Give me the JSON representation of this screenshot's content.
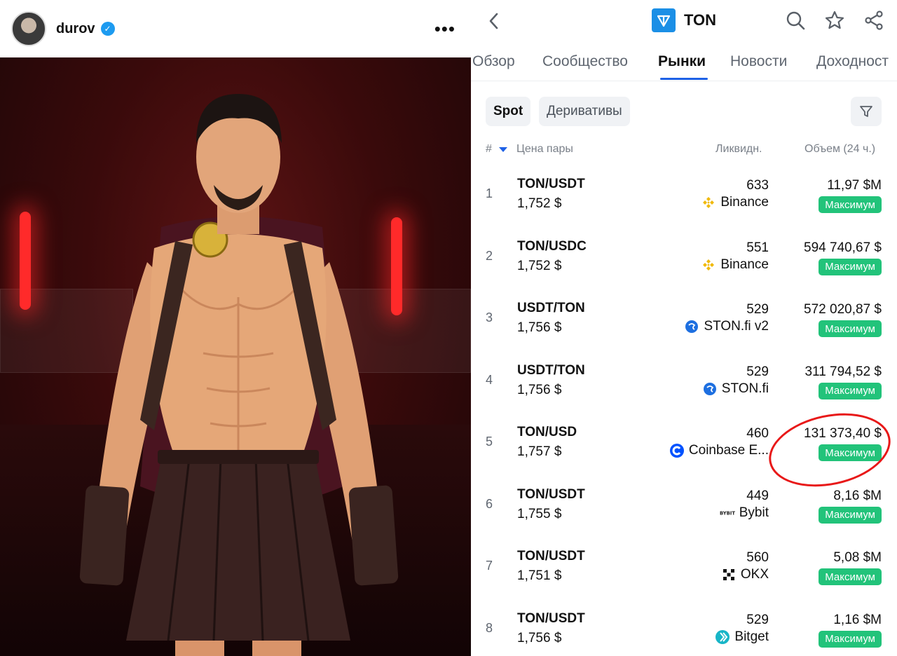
{
  "post": {
    "username": "durov",
    "more_label": "•••"
  },
  "panel": {
    "token": "TON",
    "tabs": [
      "Обзор",
      "Сообщество",
      "Рынки",
      "Новости",
      "Доходност"
    ],
    "active_tab": "Рынки",
    "chips": [
      "Spot",
      "Деривативы"
    ],
    "columns": {
      "rank": "#",
      "pair": "Цена пары",
      "liquidity": "Ликвидн.",
      "volume": "Объем (24 ч.)"
    },
    "rows": [
      {
        "rank": "1",
        "pair": "TON/USDT",
        "price": "1,752 $",
        "liquidity": "633",
        "exchange": "Binance",
        "exchange_icon": "binance-icon",
        "volume": "11,97 $M",
        "badge": "Максимум"
      },
      {
        "rank": "2",
        "pair": "TON/USDC",
        "price": "1,752 $",
        "liquidity": "551",
        "exchange": "Binance",
        "exchange_icon": "binance-icon",
        "volume": "594 740,67 $",
        "badge": "Максимум"
      },
      {
        "rank": "3",
        "pair": "USDT/TON",
        "price": "1,756 $",
        "liquidity": "529",
        "exchange": "STON.fi v2",
        "exchange_icon": "stonfi-icon",
        "volume": "572 020,87 $",
        "badge": "Максимум"
      },
      {
        "rank": "4",
        "pair": "USDT/TON",
        "price": "1,756 $",
        "liquidity": "529",
        "exchange": "STON.fi",
        "exchange_icon": "stonfi-icon",
        "volume": "311 794,52 $",
        "badge": "Максимум"
      },
      {
        "rank": "5",
        "pair": "TON/USD",
        "price": "1,757 $",
        "liquidity": "460",
        "exchange": "Coinbase E...",
        "exchange_icon": "coinbase-icon",
        "volume": "131 373,40 $",
        "badge": "Максимум"
      },
      {
        "rank": "6",
        "pair": "TON/USDT",
        "price": "1,755 $",
        "liquidity": "449",
        "exchange": "Bybit",
        "exchange_icon": "bybit-icon",
        "volume": "8,16 $M",
        "badge": "Максимум"
      },
      {
        "rank": "7",
        "pair": "TON/USDT",
        "price": "1,751 $",
        "liquidity": "560",
        "exchange": "OKX",
        "exchange_icon": "okx-icon",
        "volume": "5,08 $M",
        "badge": "Максимум"
      },
      {
        "rank": "8",
        "pair": "TON/USDT",
        "price": "1,756 $",
        "liquidity": "529",
        "exchange": "Bitget",
        "exchange_icon": "bitget-icon",
        "volume": "1,16 $M",
        "badge": "Максимум"
      }
    ]
  },
  "colors": {
    "accent": "#1e61e6",
    "badge": "#22c37a",
    "annotation": "#e81818",
    "verified": "#1d9bf0",
    "ton_brand": "#1b8fe6"
  }
}
